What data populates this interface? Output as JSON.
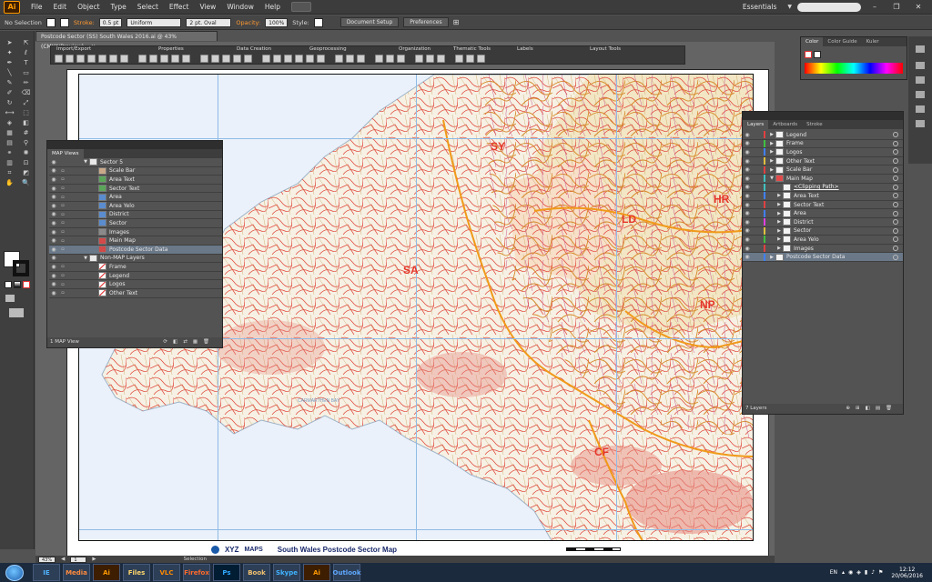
{
  "app": {
    "logo": "Ai",
    "menus": [
      "File",
      "Edit",
      "Object",
      "Type",
      "Select",
      "Effect",
      "View",
      "Window",
      "Help"
    ],
    "workspace": "Essentials"
  },
  "control": {
    "selection": "No Selection",
    "stroke_label": "Stroke:",
    "stroke_value": "0.5 pt",
    "uniform": "Uniform",
    "brush": "2 pt. Oval",
    "opacity_label": "Opacity:",
    "opacity_value": "100%",
    "style_label": "Style:",
    "doc_setup": "Document Setup",
    "preferences": "Preferences"
  },
  "document": {
    "tab_title": "Postcode Sector (SS) South Wales 2016.ai @ 43% (CMYK/Preview)"
  },
  "map_toolbar": {
    "groups": [
      "Import/Export",
      "Properties",
      "Data Creation",
      "Geoprocessing",
      "Organization",
      "Thematic Tools",
      "Labels",
      "Layout Tools"
    ]
  },
  "map": {
    "sector_labels": [
      "SY",
      "SA",
      "LD",
      "HR",
      "NP",
      "CF"
    ],
    "footer_brand": "XYZ",
    "footer_brand_sub": "MAPS",
    "footer_title": "South Wales Postcode Sector Map"
  },
  "color_panel": {
    "tabs": [
      "Color",
      "Color Guide",
      "Kuler"
    ]
  },
  "map_views": {
    "title": "MAP Views",
    "items": [
      {
        "label": "Sector 5",
        "thumb": "group"
      },
      {
        "label": "Scale Bar",
        "thumb": "tan"
      },
      {
        "label": "Area Text",
        "thumb": "green"
      },
      {
        "label": "Sector Text",
        "thumb": "green"
      },
      {
        "label": "Area",
        "thumb": "blue"
      },
      {
        "label": "Area Yelo",
        "thumb": "blue"
      },
      {
        "label": "District",
        "thumb": "blue"
      },
      {
        "label": "Sector",
        "thumb": "blue"
      },
      {
        "label": "Images",
        "thumb": "none"
      },
      {
        "label": "Main Map",
        "thumb": "red"
      },
      {
        "label": "Postcode Sector Data",
        "thumb": "red"
      },
      {
        "label": "Non-MAP Layers",
        "thumb": "group"
      },
      {
        "label": "Frame",
        "thumb": "slash"
      },
      {
        "label": "Legend",
        "thumb": "slash"
      },
      {
        "label": "Logos",
        "thumb": "slash"
      },
      {
        "label": "Other Text",
        "thumb": "slash"
      }
    ],
    "footer": "1 MAP View"
  },
  "layers": {
    "tabs": [
      "Layers",
      "Artboards",
      "Stroke"
    ],
    "items": [
      {
        "label": "Legend",
        "color": "#e04040"
      },
      {
        "label": "Frame",
        "color": "#40c040"
      },
      {
        "label": "Logos",
        "color": "#4080ff"
      },
      {
        "label": "Other Text",
        "color": "#e0c040"
      },
      {
        "label": "Scale Bar",
        "color": "#e04040"
      },
      {
        "label": "Main Map",
        "color": "#40c0c0"
      },
      {
        "label": "<Clipping Path>",
        "color": "#40c0c0"
      },
      {
        "label": "Area Text",
        "color": "#4080ff"
      },
      {
        "label": "Sector Text",
        "color": "#e04040"
      },
      {
        "label": "Area",
        "color": "#4080ff"
      },
      {
        "label": "District",
        "color": "#e040e0"
      },
      {
        "label": "Sector",
        "color": "#e0c040"
      },
      {
        "label": "Area Yelo",
        "color": "#40c040"
      },
      {
        "label": "Images",
        "color": "#e04040"
      },
      {
        "label": "Postcode Sector Data",
        "color": "#4080ff"
      }
    ],
    "footer": "7 Layers"
  },
  "status": {
    "zoom": "43%",
    "page": "1",
    "mode": "Selection"
  },
  "taskbar": {
    "apps": [
      "IE",
      "Media",
      "Ai",
      "Files",
      "VLC",
      "Firefox",
      "Ps",
      "Book",
      "Skype",
      "Ai",
      "Outlook"
    ],
    "lang": "EN",
    "time": "12:12",
    "date": "20/06/2016"
  }
}
